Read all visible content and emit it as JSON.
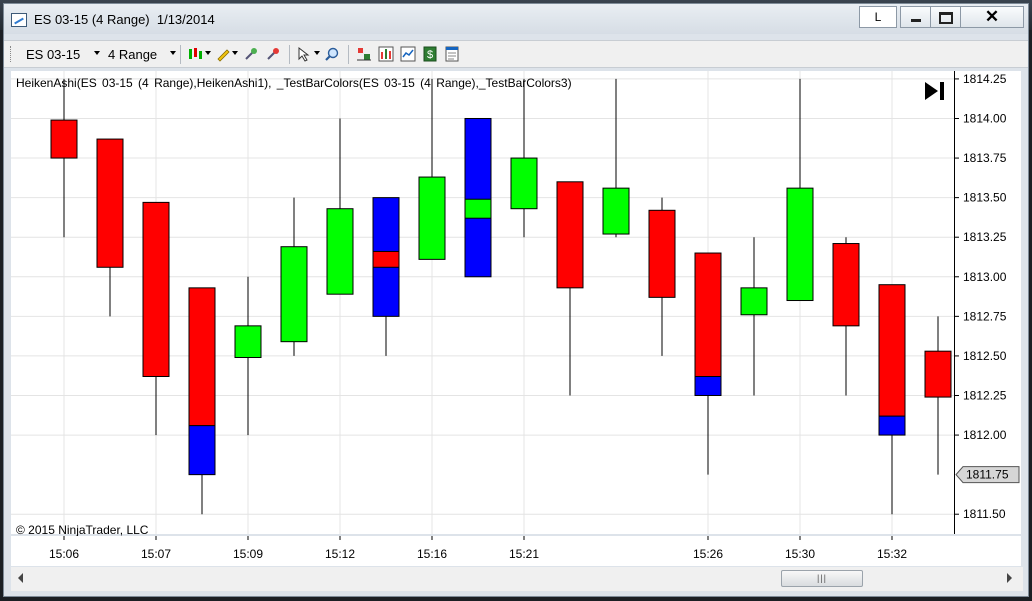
{
  "window": {
    "title": "ES 03-15 (4 Range)  1/13/2014",
    "link_button_label": "L"
  },
  "toolbar": {
    "instrument_label": "ES 03-15",
    "period_label": "4 Range",
    "icons": [
      "bar-type-icon",
      "drawing-tools-icon",
      "zoom-in-icon",
      "zoom-out-icon",
      "cursor-icon",
      "magnifier-icon",
      "indicators-icon",
      "strategies-icon",
      "properties-icon",
      "order-icon",
      "data-box-icon"
    ]
  },
  "chart": {
    "indicator_label": "HeikenAshi(ES 03-15 (4 Range),HeikenAshi1), _TestBarColors(ES 03-15 (4 Range),_TestBarColors3)",
    "copyright": "© 2015 NinjaTrader, LLC",
    "current_price_label": "1811.75",
    "colors": {
      "up": "#00ff00",
      "down": "#ff0000",
      "highlight": "#0000ff",
      "grid": "#e4e4e4"
    }
  },
  "chart_data": {
    "type": "candlestick",
    "ylim": [
      1811.375,
      1814.3
    ],
    "y_ticks": [
      1814.25,
      1814.0,
      1813.75,
      1813.5,
      1813.25,
      1813.0,
      1812.75,
      1812.5,
      1812.25,
      1812.0,
      1811.5
    ],
    "y_tick_labels": [
      "1814.25",
      "1814.00",
      "1813.75",
      "1813.50",
      "1813.25",
      "1813.00",
      "1812.75",
      "1812.50",
      "1812.25",
      "1812.00",
      "1811.50"
    ],
    "x_tick_labels": [
      "15:06",
      "15:07",
      "15:09",
      "15:12",
      "15:16",
      "15:21",
      "15:26",
      "15:30",
      "15:32"
    ],
    "x_tick_bar_positions": [
      1,
      3,
      5,
      7,
      9,
      11,
      15,
      17,
      19
    ],
    "x_tick_value_labels": [
      "15:06",
      "15:07",
      "15:09",
      "15:12",
      "15:16",
      "15:21",
      "15:26",
      "15:30",
      "15:32"
    ],
    "bars": [
      {
        "color": "down",
        "high": 1814.25,
        "low": 1813.25,
        "open": 1813.99,
        "close": 1813.75
      },
      {
        "color": "down",
        "high": 1813.87,
        "low": 1812.75,
        "open": 1813.87,
        "close": 1813.06
      },
      {
        "color": "down",
        "high": 1813.47,
        "low": 1812.0,
        "open": 1813.47,
        "close": 1812.37
      },
      {
        "color": "down",
        "high": 1812.93,
        "low": 1811.5,
        "open": 1812.93,
        "close": 1812.06,
        "blue_body_low": 1811.75,
        "blue_wick_high": 1812.5
      },
      {
        "color": "up",
        "high": 1813.0,
        "low": 1812.0,
        "open": 1812.49,
        "close": 1812.69
      },
      {
        "color": "up",
        "high": 1813.5,
        "low": 1812.5,
        "open": 1812.59,
        "close": 1813.19
      },
      {
        "color": "up",
        "high": 1814.0,
        "low": 1813.0,
        "open": 1812.89,
        "close": 1813.43
      },
      {
        "color": "down",
        "high": 1813.5,
        "low": 1812.5,
        "open": 1813.16,
        "close": 1813.06,
        "blue_body_low": 1812.75,
        "blue_body_high": 1813.5
      },
      {
        "color": "up",
        "high": 1814.25,
        "low": 1813.5,
        "open": 1813.11,
        "close": 1813.63
      },
      {
        "color": "up",
        "high": 1814.0,
        "low": 1813.0,
        "open": 1813.37,
        "close": 1813.49,
        "blue_body_low": 1813.0,
        "blue_body_high": 1814.0
      },
      {
        "color": "up",
        "high": 1814.25,
        "low": 1813.25,
        "open": 1813.43,
        "close": 1813.75
      },
      {
        "color": "down",
        "high": 1813.6,
        "low": 1812.25,
        "open": 1813.6,
        "close": 1812.93,
        "blue_wick_high": 1813.25
      },
      {
        "color": "up",
        "high": 1814.25,
        "low": 1813.25,
        "open": 1813.27,
        "close": 1813.56
      },
      {
        "color": "down",
        "high": 1813.5,
        "low": 1812.5,
        "open": 1813.42,
        "close": 1812.87
      },
      {
        "color": "down",
        "high": 1813.15,
        "low": 1811.75,
        "open": 1813.15,
        "close": 1812.37,
        "blue_body_low": 1812.25,
        "blue_wick_high": 1812.75
      },
      {
        "color": "up",
        "high": 1813.25,
        "low": 1812.25,
        "open": 1812.76,
        "close": 1812.93
      },
      {
        "color": "up",
        "high": 1814.25,
        "low": 1812.85,
        "open": 1812.85,
        "close": 1813.56
      },
      {
        "color": "down",
        "high": 1813.25,
        "low": 1812.25,
        "open": 1813.21,
        "close": 1812.69
      },
      {
        "color": "down",
        "high": 1812.95,
        "low": 1811.5,
        "open": 1812.95,
        "close": 1812.12,
        "blue_body_low": 1812.0,
        "blue_wick_high": 1812.5
      },
      {
        "color": "down",
        "high": 1812.75,
        "low": 1811.75,
        "open": 1812.53,
        "close": 1812.24
      }
    ]
  }
}
